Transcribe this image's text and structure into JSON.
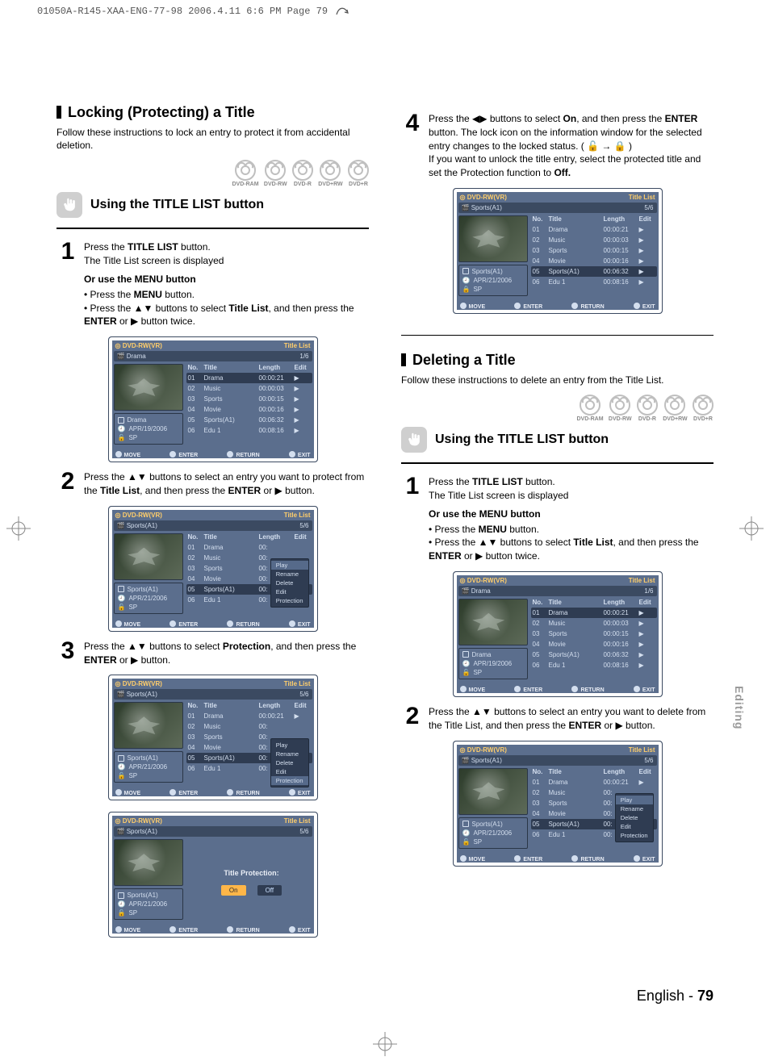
{
  "print_header": "01050A-R145-XAA-ENG-77-98  2006.4.11  6:6 PM  Page 79",
  "side_tab": "Editing",
  "page_number_label": "English - ",
  "page_number": "79",
  "disc_labels": [
    "DVD-RAM",
    "DVD-RW",
    "DVD-R",
    "DVD+RW",
    "DVD+R"
  ],
  "nav": {
    "move": "MOVE",
    "enter": "ENTER",
    "return": "RETURN",
    "exit": "EXIT"
  },
  "osd_common": {
    "device": "DVD-RW(VR)",
    "title_label": "Title List",
    "cols": {
      "no": "No.",
      "title": "Title",
      "length": "Length",
      "edit": "Edit"
    }
  },
  "context_menu": {
    "items": [
      "Play",
      "Rename",
      "Delete",
      "Edit",
      "Protection"
    ],
    "play": "Play",
    "rename": "Rename",
    "delete": "Delete",
    "edit": "Edit",
    "protection": "Protection"
  },
  "rows_vr": [
    {
      "no": "01",
      "title": "Drama",
      "len": "00:00:21"
    },
    {
      "no": "02",
      "title": "Music",
      "len": "00:00:03"
    },
    {
      "no": "03",
      "title": "Sports",
      "len": "00:00:15"
    },
    {
      "no": "04",
      "title": "Movie",
      "len": "00:00:16"
    },
    {
      "no": "05",
      "title": "Sports(A1)",
      "len": "00:06:32"
    },
    {
      "no": "06",
      "title": "Edu 1",
      "len": "00:08:16"
    }
  ],
  "osd1": {
    "subtitle": "Drama",
    "page": "1/6",
    "meta": {
      "name": "Drama",
      "date": "APR/19/2006",
      "mode": "SP"
    }
  },
  "osd_sports": {
    "subtitle": "Sports(A1)",
    "page": "5/6",
    "meta": {
      "name": "Sports(A1)",
      "date": "APR/21/2006",
      "mode": "SP"
    }
  },
  "protection_panel": {
    "title": "Title Protection:",
    "on": "On",
    "off": "Off"
  },
  "left": {
    "sec1_title": "Locking (Protecting) a Title",
    "sec1_desc": "Follow these instructions to lock an entry to protect it from accidental deletion.",
    "using": "Using the TITLE LIST button",
    "step1a": "Press the ",
    "step1b_bold": "TITLE LIST",
    "step1c": " button.",
    "step1d": "The Title List screen is displayed",
    "step1_sub": "Or use the MENU button",
    "step1_li1_a": "Press the ",
    "step1_li1_b": "MENU",
    "step1_li1_c": " button.",
    "step1_li2_a": "Press the ▲▼ buttons to select ",
    "step1_li2_b": "Title List",
    "step1_li2_c": ", and then press the ",
    "step1_li2_d": "ENTER",
    "step1_li2_e": " or ▶ button twice.",
    "step2": "Press the ▲▼ buttons to select an entry you want to protect from the ",
    "step2b": "Title List",
    "step2c": ", and then press the ",
    "step2d": "ENTER",
    "step2e": " or ▶ button.",
    "step3a": "Press the ▲▼ buttons to select ",
    "step3b": "Protection",
    "step3c": ", and then press the ",
    "step3d": "ENTER",
    "step3e": " or ▶ button."
  },
  "right": {
    "step4a": "Press the ◀▶ buttons to select ",
    "step4b": "On",
    "step4c": ", and then press the ",
    "step4d": "ENTER",
    "step4e": " button. The lock icon on the information window for the selected entry changes to the locked status. ( 🔓 → 🔒 )",
    "step4f": "If you want to unlock the title entry, select the protected title and set the Protection function to ",
    "step4g": "Off.",
    "sec2_title": "Deleting a Title",
    "sec2_desc": "Follow these instructions to delete an entry from the Title List.",
    "using": "Using the TITLE LIST button",
    "step1a": "Press the ",
    "step1b_bold": "TITLE LIST",
    "step1c": " button.",
    "step1d": "The Title List screen is displayed",
    "step1_sub": "Or use the MENU button",
    "step1_li1_a": "Press the ",
    "step1_li1_b": "MENU",
    "step1_li1_c": " button.",
    "step1_li2_a": "Press the ▲▼ buttons to select ",
    "step1_li2_b": "Title List",
    "step1_li2_c": ", and then press the ",
    "step1_li2_d": "ENTER",
    "step1_li2_e": " or ▶ button twice.",
    "step2a": "Press the ▲▼ buttons to select an entry you want to delete from the Title List, and then press the ",
    "step2b": "ENTER",
    "step2c": " or ▶ button."
  }
}
